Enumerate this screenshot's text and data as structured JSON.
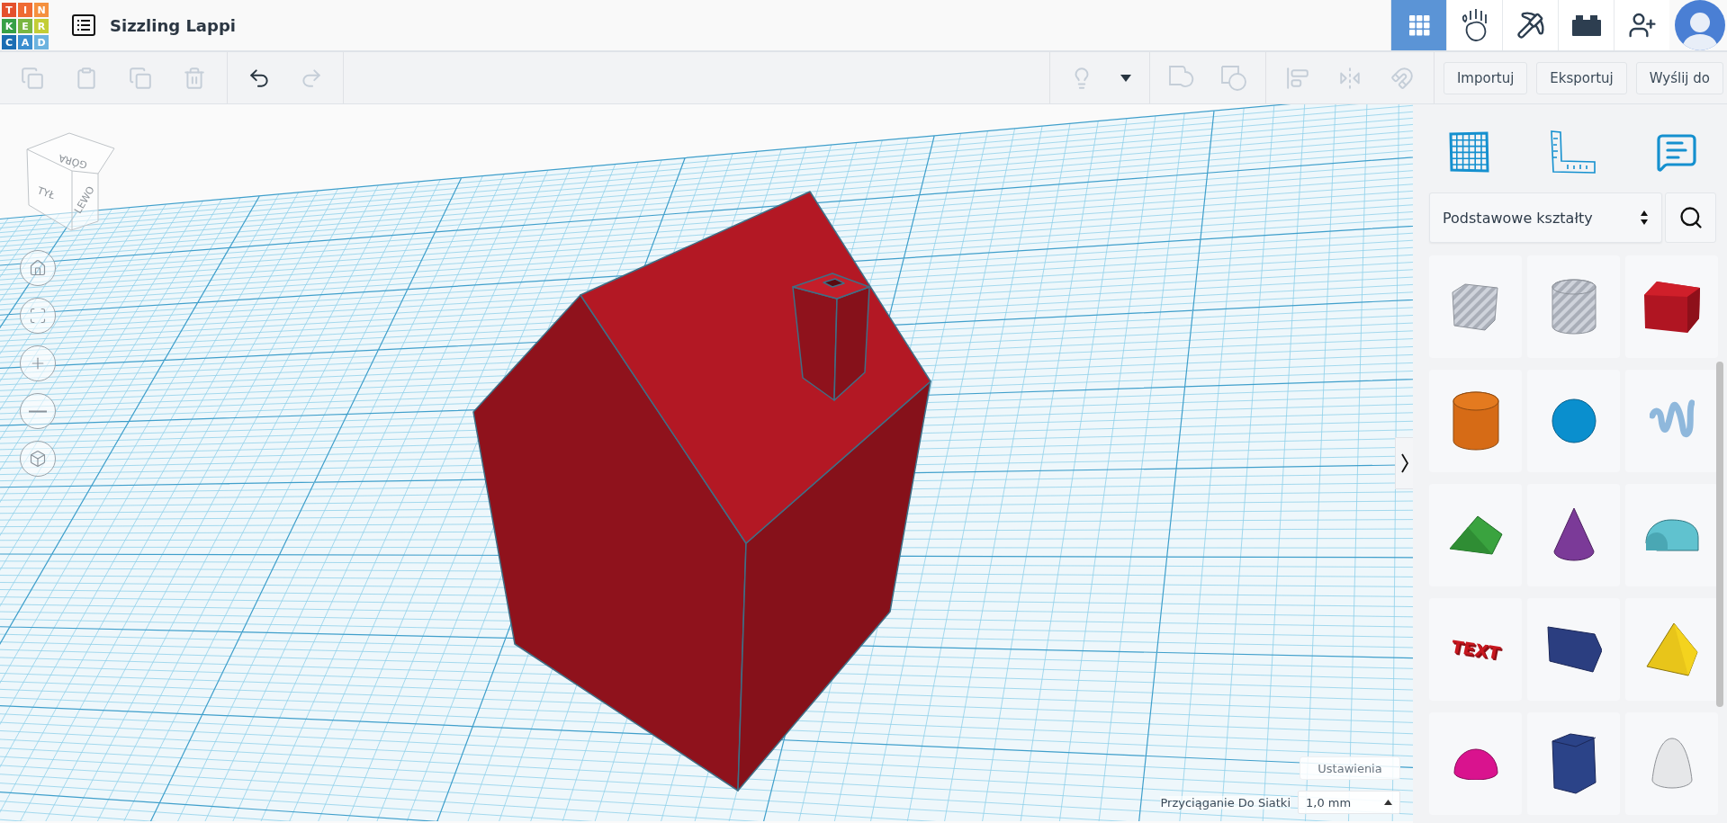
{
  "header": {
    "logo": [
      {
        "letter": "T",
        "color": "#e4502c"
      },
      {
        "letter": "I",
        "color": "#ef6a33"
      },
      {
        "letter": "N",
        "color": "#f5903e"
      },
      {
        "letter": "K",
        "color": "#37a046"
      },
      {
        "letter": "E",
        "color": "#7ab642"
      },
      {
        "letter": "R",
        "color": "#c3cd35"
      },
      {
        "letter": "C",
        "color": "#1a6db3"
      },
      {
        "letter": "A",
        "color": "#3b8ecf"
      },
      {
        "letter": "D",
        "color": "#6cb3df"
      }
    ],
    "title": "Sizzling Lappi",
    "nav": [
      {
        "kind": "designs",
        "selected": true
      },
      {
        "kind": "tinker",
        "selected": false
      },
      {
        "kind": "pickaxe",
        "selected": false
      },
      {
        "kind": "brick",
        "selected": false
      },
      {
        "kind": "add-user",
        "selected": false
      }
    ]
  },
  "toolbar": {
    "edit_tools": [
      {
        "kind": "copy",
        "disabled": true
      },
      {
        "kind": "paste",
        "disabled": true
      },
      {
        "kind": "duplicate",
        "disabled": true
      },
      {
        "kind": "delete",
        "disabled": true
      }
    ],
    "history": [
      {
        "kind": "undo",
        "disabled": false
      },
      {
        "kind": "redo",
        "disabled": true
      }
    ],
    "view_tools": [
      {
        "kind": "light",
        "disabled": true
      },
      {
        "kind": "dropdown",
        "disabled": false
      }
    ],
    "shape_tools": [
      {
        "kind": "group",
        "disabled": true
      },
      {
        "kind": "ungroup",
        "disabled": true
      }
    ],
    "arrange_tools": [
      {
        "kind": "align",
        "disabled": true
      },
      {
        "kind": "mirror",
        "disabled": true
      },
      {
        "kind": "cruise",
        "disabled": true
      }
    ],
    "actions": [
      "Importuj",
      "Eksportuj",
      "Wyślij do"
    ]
  },
  "canvas": {
    "view_cube": [
      "GÓRA",
      "TYŁ",
      "LEWO"
    ],
    "view_controls": [
      {
        "kind": "home"
      },
      {
        "kind": "fit"
      },
      {
        "kind": "zoom-in"
      },
      {
        "kind": "zoom-out"
      },
      {
        "kind": "perspective"
      }
    ],
    "settings_button": "Ustawienia",
    "snap": {
      "label": "Przyciąganie Do Siatki",
      "value": "1,0 mm"
    }
  },
  "panel": {
    "tools": [
      {
        "kind": "workplane"
      },
      {
        "kind": "ruler"
      },
      {
        "kind": "notes"
      }
    ],
    "category": "Podstawowe kształty",
    "shapes": [
      {
        "kind": "box-hole"
      },
      {
        "kind": "cylinder-hole"
      },
      {
        "kind": "box"
      },
      {
        "kind": "cylinder"
      },
      {
        "kind": "sphere"
      },
      {
        "kind": "scribble"
      },
      {
        "kind": "roof"
      },
      {
        "kind": "cone"
      },
      {
        "kind": "round-roof"
      },
      {
        "kind": "text",
        "label": "TEXT"
      },
      {
        "kind": "prism"
      },
      {
        "kind": "pyramid"
      },
      {
        "kind": "half-sphere"
      },
      {
        "kind": "polygon"
      },
      {
        "kind": "paraboloid"
      }
    ]
  }
}
